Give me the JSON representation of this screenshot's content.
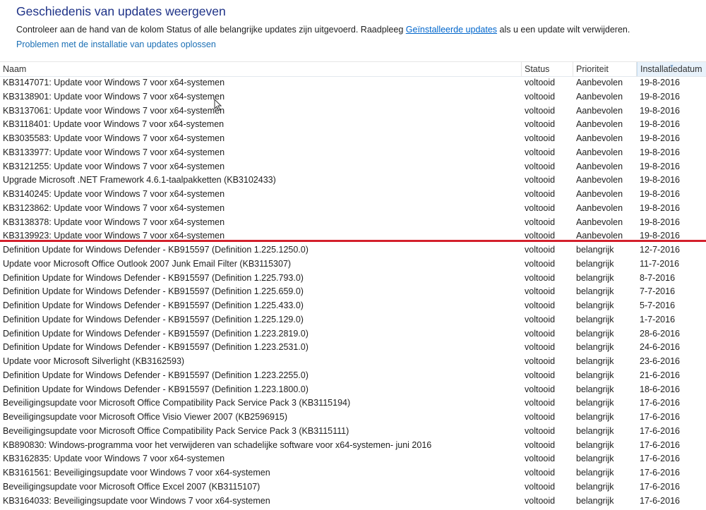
{
  "page": {
    "title": "Geschiedenis van updates weergeven",
    "description_before": "Controleer aan de hand van de kolom Status of alle belangrijke updates zijn uitgevoerd. Raadpleeg ",
    "description_link": "Geïnstalleerde updates",
    "description_after": " als u een update wilt verwijderen.",
    "troubleshoot_link": "Problemen met de installatie van updates oplossen"
  },
  "columns": {
    "name": "Naam",
    "status": "Status",
    "priority": "Prioriteit",
    "date": "Installatiedatum"
  },
  "colors": {
    "accent": "#1e3287",
    "link": "#0066cc",
    "annotation_line": "#d4202c"
  },
  "updates": [
    {
      "name": "KB3147071: Update voor Windows 7 voor x64-systemen",
      "status": "voltooid",
      "priority": "Aanbevolen",
      "date": "19-8-2016"
    },
    {
      "name": "KB3138901: Update voor Windows 7 voor x64-systemen",
      "status": "voltooid",
      "priority": "Aanbevolen",
      "date": "19-8-2016"
    },
    {
      "name": "KB3137061: Update voor Windows 7 voor x64-systemen",
      "status": "voltooid",
      "priority": "Aanbevolen",
      "date": "19-8-2016"
    },
    {
      "name": "KB3118401: Update voor Windows 7 voor x64-systemen",
      "status": "voltooid",
      "priority": "Aanbevolen",
      "date": "19-8-2016"
    },
    {
      "name": "KB3035583: Update voor Windows 7 voor x64-systemen",
      "status": "voltooid",
      "priority": "Aanbevolen",
      "date": "19-8-2016"
    },
    {
      "name": "KB3133977: Update voor Windows 7 voor x64-systemen",
      "status": "voltooid",
      "priority": "Aanbevolen",
      "date": "19-8-2016"
    },
    {
      "name": "KB3121255: Update voor Windows 7 voor x64-systemen",
      "status": "voltooid",
      "priority": "Aanbevolen",
      "date": "19-8-2016"
    },
    {
      "name": "Upgrade Microsoft .NET Framework 4.6.1-taalpakketten (KB3102433)",
      "status": "voltooid",
      "priority": "Aanbevolen",
      "date": "19-8-2016"
    },
    {
      "name": "KB3140245: Update voor Windows 7 voor x64-systemen",
      "status": "voltooid",
      "priority": "Aanbevolen",
      "date": "19-8-2016"
    },
    {
      "name": "KB3123862: Update voor Windows 7 voor x64-systemen",
      "status": "voltooid",
      "priority": "Aanbevolen",
      "date": "19-8-2016"
    },
    {
      "name": "KB3138378: Update voor Windows 7 voor x64-systemen",
      "status": "voltooid",
      "priority": "Aanbevolen",
      "date": "19-8-2016"
    },
    {
      "name": "KB3139923: Update voor Windows 7 voor x64-systemen",
      "status": "voltooid",
      "priority": "Aanbevolen",
      "date": "19-8-2016"
    },
    {
      "name": "Definition Update for Windows Defender - KB915597 (Definition 1.225.1250.0)",
      "status": "voltooid",
      "priority": "belangrijk",
      "date": "12-7-2016"
    },
    {
      "name": "Update voor Microsoft Office Outlook 2007 Junk Email Filter (KB3115307)",
      "status": "voltooid",
      "priority": "belangrijk",
      "date": "11-7-2016"
    },
    {
      "name": "Definition Update for Windows Defender - KB915597 (Definition 1.225.793.0)",
      "status": "voltooid",
      "priority": "belangrijk",
      "date": "8-7-2016"
    },
    {
      "name": "Definition Update for Windows Defender - KB915597 (Definition 1.225.659.0)",
      "status": "voltooid",
      "priority": "belangrijk",
      "date": "7-7-2016"
    },
    {
      "name": "Definition Update for Windows Defender - KB915597 (Definition 1.225.433.0)",
      "status": "voltooid",
      "priority": "belangrijk",
      "date": "5-7-2016"
    },
    {
      "name": "Definition Update for Windows Defender - KB915597 (Definition 1.225.129.0)",
      "status": "voltooid",
      "priority": "belangrijk",
      "date": "1-7-2016"
    },
    {
      "name": "Definition Update for Windows Defender - KB915597 (Definition 1.223.2819.0)",
      "status": "voltooid",
      "priority": "belangrijk",
      "date": "28-6-2016"
    },
    {
      "name": "Definition Update for Windows Defender - KB915597 (Definition 1.223.2531.0)",
      "status": "voltooid",
      "priority": "belangrijk",
      "date": "24-6-2016"
    },
    {
      "name": "Update voor Microsoft Silverlight (KB3162593)",
      "status": "voltooid",
      "priority": "belangrijk",
      "date": "23-6-2016"
    },
    {
      "name": "Definition Update for Windows Defender - KB915597 (Definition 1.223.2255.0)",
      "status": "voltooid",
      "priority": "belangrijk",
      "date": "21-6-2016"
    },
    {
      "name": "Definition Update for Windows Defender - KB915597 (Definition 1.223.1800.0)",
      "status": "voltooid",
      "priority": "belangrijk",
      "date": "18-6-2016"
    },
    {
      "name": "Beveiligingsupdate voor Microsoft Office Compatibility Pack Service Pack 3 (KB3115194)",
      "status": "voltooid",
      "priority": "belangrijk",
      "date": "17-6-2016"
    },
    {
      "name": "Beveiligingsupdate voor Microsoft Office Visio Viewer 2007 (KB2596915)",
      "status": "voltooid",
      "priority": "belangrijk",
      "date": "17-6-2016"
    },
    {
      "name": "Beveiligingsupdate voor Microsoft Office Compatibility Pack Service Pack 3 (KB3115111)",
      "status": "voltooid",
      "priority": "belangrijk",
      "date": "17-6-2016"
    },
    {
      "name": "KB890830: Windows-programma voor het verwijderen van schadelijke software voor x64-systemen- juni 2016",
      "status": "voltooid",
      "priority": "belangrijk",
      "date": "17-6-2016"
    },
    {
      "name": "KB3162835: Update voor Windows 7 voor x64-systemen",
      "status": "voltooid",
      "priority": "belangrijk",
      "date": "17-6-2016"
    },
    {
      "name": "KB3161561: Beveiligingsupdate voor Windows 7 voor x64-systemen",
      "status": "voltooid",
      "priority": "belangrijk",
      "date": "17-6-2016"
    },
    {
      "name": "Beveiligingsupdate voor Microsoft Office Excel 2007 (KB3115107)",
      "status": "voltooid",
      "priority": "belangrijk",
      "date": "17-6-2016"
    },
    {
      "name": "KB3164033: Beveiligingsupdate voor Windows 7 voor x64-systemen",
      "status": "voltooid",
      "priority": "belangrijk",
      "date": "17-6-2016"
    }
  ]
}
